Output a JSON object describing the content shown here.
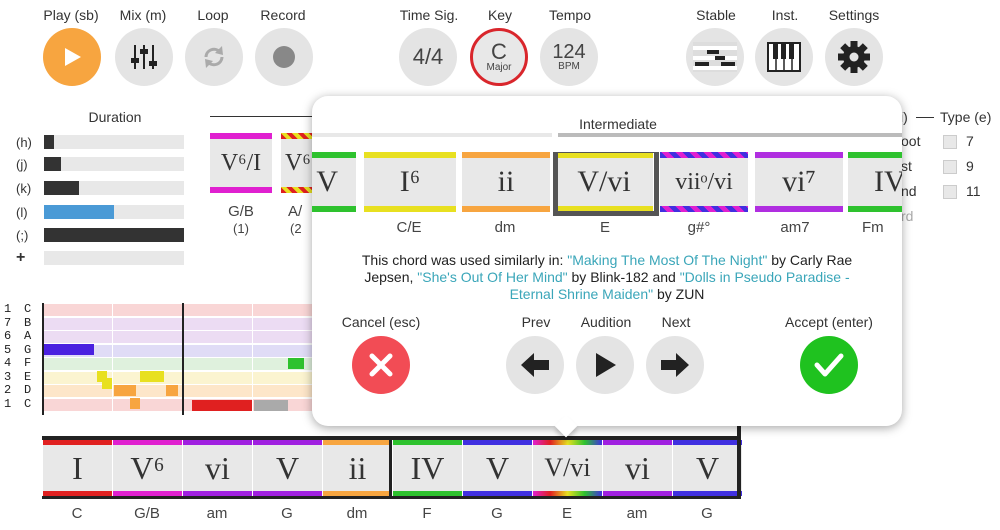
{
  "top": {
    "play_label": "Play (sb)",
    "mix_label": "Mix (m)",
    "loop_label": "Loop",
    "record_label": "Record",
    "timesig_label": "Time Sig.",
    "timesig_value": "4/4",
    "key_label": "Key",
    "key_value": "C",
    "key_mode": "Major",
    "tempo_label": "Tempo",
    "tempo_value": "124",
    "tempo_unit": "BPM",
    "stable_label": "Stable",
    "inst_label": "Inst.",
    "settings_label": "Settings"
  },
  "duration": {
    "title": "Duration",
    "rows": [
      {
        "key": "(h)",
        "fill": 0.07,
        "color": "#333333"
      },
      {
        "key": "(j)",
        "fill": 0.12,
        "color": "#333333"
      },
      {
        "key": "(k)",
        "fill": 0.25,
        "color": "#333333"
      },
      {
        "key": "(l)",
        "fill": 0.5,
        "color": "#4a9ad6"
      },
      {
        "key": "(;)",
        "fill": 1.0,
        "color": "#333333"
      },
      {
        "key": "+",
        "fill": 0.0,
        "color": "#333333"
      }
    ]
  },
  "palette_left": [
    {
      "numeral": "V⁶/I",
      "name": "G/B",
      "index": "(1)"
    },
    {
      "numeral": "V⁶",
      "name": "A/",
      "index": "(2"
    }
  ],
  "type_panel": {
    "title": "Type (e)",
    "col_prefix": "i)",
    "options": [
      "7",
      "9",
      "11"
    ],
    "side_labels": [
      "oot",
      "st",
      "nd",
      "rd"
    ]
  },
  "popup": {
    "level": "Intermediate",
    "cards": [
      {
        "numeral": "V",
        "name": "",
        "top": "#2ec22e",
        "bot": "#2ec22e"
      },
      {
        "numeral": "I⁶",
        "name": "C/E",
        "top": "#e8e020",
        "bot": "#e8e020"
      },
      {
        "numeral": "ii",
        "name": "dm",
        "top": "#f7a540",
        "bot": "#f7a540"
      },
      {
        "numeral": "V/vi",
        "name": "E",
        "top": "#e8e020",
        "bot": "#e8e020"
      },
      {
        "numeral": "viiᵒ/vi",
        "name": "g#°",
        "top": "#7a2ee0",
        "bot": "#7a2ee0"
      },
      {
        "numeral": "vi⁷",
        "name": "am7",
        "top": "#b02ee0",
        "bot": "#b02ee0"
      },
      {
        "numeral": "IV",
        "name": "Fm",
        "top": "#2ec22e",
        "bot": "#2ec22e"
      }
    ],
    "desc_prefix": "This chord was used similarly in: ",
    "song1": "\"Making The Most Of The Night\"",
    "by1": " by Carly Rae Jepsen, ",
    "song2": "\"She's Out Of Her Mind\"",
    "by2": " by Blink-182 and ",
    "song3": "\"Dolls in Pseudo Paradise - Eternal Shrine Maiden\"",
    "by3": " by ZUN",
    "cancel_label": "Cancel (esc)",
    "prev_label": "Prev",
    "audition_label": "Audition",
    "next_label": "Next",
    "accept_label": "Accept (enter)",
    "link_color": "#3aa6b9"
  },
  "roll": {
    "rows": [
      {
        "num": "1",
        "note": "C"
      },
      {
        "num": "7",
        "note": "B"
      },
      {
        "num": "6",
        "note": "A"
      },
      {
        "num": "5",
        "note": "G"
      },
      {
        "num": "4",
        "note": "F"
      },
      {
        "num": "3",
        "note": "E"
      },
      {
        "num": "2",
        "note": "D"
      },
      {
        "num": "1",
        "note": "C"
      }
    ]
  },
  "progression": [
    {
      "numeral": "I",
      "name": "C",
      "color": "#e02020"
    },
    {
      "numeral": "V⁶",
      "name": "G/B",
      "color": "#e020d0"
    },
    {
      "numeral": "vi",
      "name": "am",
      "color": "#a020e0"
    },
    {
      "numeral": "V",
      "name": "G",
      "color": "#a020e0"
    },
    {
      "numeral": "ii",
      "name": "dm",
      "color": "#f7a540"
    },
    {
      "numeral": "IV",
      "name": "F",
      "color": "#2ec22e"
    },
    {
      "numeral": "V",
      "name": "G",
      "color": "#4030e0"
    },
    {
      "numeral": "V/vi",
      "name": "E",
      "color": "#e8e020"
    },
    {
      "numeral": "vi",
      "name": "am",
      "color": "#a020e0"
    },
    {
      "numeral": "V",
      "name": "G",
      "color": "#4030e0"
    }
  ]
}
